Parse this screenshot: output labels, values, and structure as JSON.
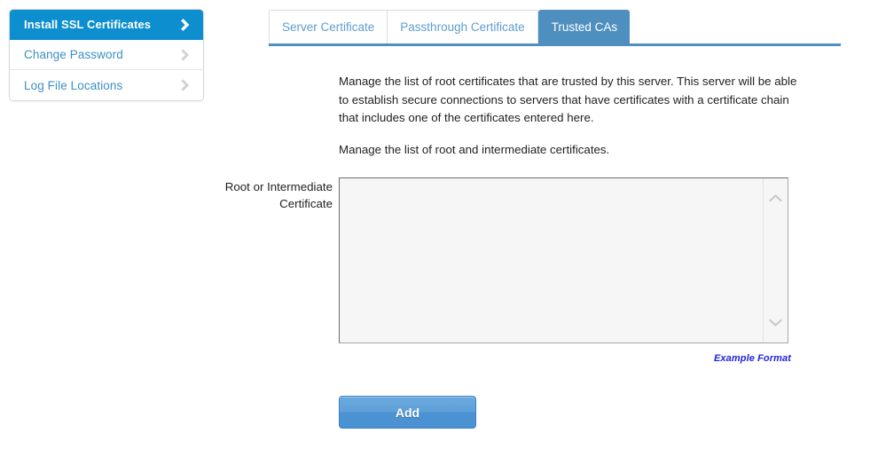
{
  "sidebar": {
    "items": [
      {
        "label": "Install SSL Certificates",
        "active": true,
        "icon": "chevron-right-icon"
      },
      {
        "label": "Change Password",
        "active": false,
        "icon": "chevron-right-icon"
      },
      {
        "label": "Log File Locations",
        "active": false,
        "icon": "chevron-right-icon"
      }
    ]
  },
  "tabs": [
    {
      "label": "Server Certificate",
      "active": false
    },
    {
      "label": "Passthrough Certificate",
      "active": false
    },
    {
      "label": "Trusted CAs",
      "active": true
    }
  ],
  "main": {
    "paragraph_1": "Manage the list of root certificates that are trusted by this server. This server will be able to establish secure connections to servers that have certificates with a certificate chain that includes one of the certificates entered here.",
    "paragraph_2": "Manage the list of root and intermediate certificates.",
    "field_label_line1": "Root or Intermediate",
    "field_label_line2": "Certificate",
    "certificate_value": "",
    "certificate_placeholder": "",
    "example_link": "Example Format",
    "add_button": "Add",
    "scroll_up_icon": "chevron-up-icon",
    "scroll_down_icon": "chevron-down-icon"
  },
  "colors": {
    "sidebar_active_bg": "#0d8ecf",
    "sidebar_link": "#3d8fc4",
    "tab_active_bg": "#4f8fbf",
    "tab_link": "#5f9ecf",
    "tabbar_underline": "#4f8fbf",
    "link_blue": "#2222dd",
    "button_blue": "#4a92d2",
    "textarea_bg": "#f6f6f6"
  }
}
